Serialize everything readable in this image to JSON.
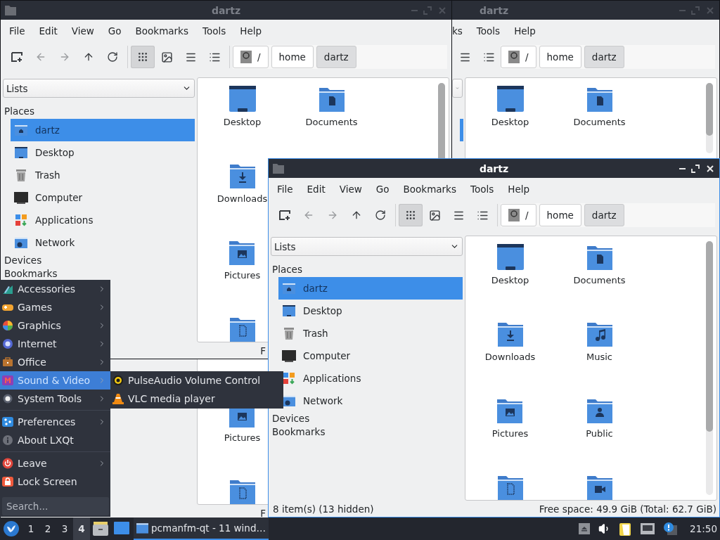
{
  "windows": [
    {
      "title": "dartz",
      "active": false,
      "menu": [
        "File",
        "Edit",
        "View",
        "Go",
        "Bookmarks",
        "Tools",
        "Help"
      ],
      "view_buttons": [
        {
          "kind": "icons",
          "selected": true
        },
        {
          "kind": "thumbnails",
          "selected": false
        },
        {
          "kind": "details",
          "selected": false
        },
        {
          "kind": "compact",
          "selected": false
        }
      ],
      "path": [
        {
          "label": "/",
          "selected": false
        },
        {
          "label": "home",
          "selected": false
        },
        {
          "label": "dartz",
          "selected": true
        }
      ],
      "view_selector": "Lists",
      "places_heading": "Places",
      "places": [
        {
          "label": "dartz",
          "kind": "home",
          "selected": true
        },
        {
          "label": "Desktop",
          "kind": "desktop",
          "selected": false
        },
        {
          "label": "Trash",
          "kind": "trash",
          "selected": false
        },
        {
          "label": "Computer",
          "kind": "computer",
          "selected": false
        },
        {
          "label": "Applications",
          "kind": "applications",
          "selected": false
        },
        {
          "label": "Network",
          "kind": "network",
          "selected": false
        }
      ],
      "sections": [
        "Devices",
        "Bookmarks"
      ],
      "files": [
        {
          "label": "Desktop",
          "kind": "desktop"
        },
        {
          "label": "Documents",
          "kind": "documents"
        },
        {
          "label": "Downloads",
          "kind": "downloads"
        },
        {
          "label": "Pictures",
          "kind": "pictures"
        },
        {
          "kind": "templates"
        }
      ],
      "status_right": "F"
    },
    {
      "title": "dartz",
      "active": false,
      "menu": [
        "ks",
        "Tools",
        "Help"
      ],
      "view_buttons": [
        {
          "kind": "details",
          "selected": false
        },
        {
          "kind": "compact",
          "selected": false
        }
      ],
      "path": [
        {
          "label": "/",
          "selected": false
        },
        {
          "label": "home",
          "selected": false
        },
        {
          "label": "dartz",
          "selected": true
        }
      ],
      "places": [
        {
          "selected": true
        }
      ],
      "files": [
        {
          "label": "Desktop",
          "kind": "desktop"
        },
        {
          "label": "Documents",
          "kind": "documents"
        }
      ]
    },
    {
      "files": [
        {
          "label": "Pictures",
          "kind": "pictures"
        },
        {
          "kind": "templates"
        }
      ],
      "status_right": "F"
    },
    {
      "title": "dartz",
      "active": true,
      "menu": [
        "File",
        "Edit",
        "View",
        "Go",
        "Bookmarks",
        "Tools",
        "Help"
      ],
      "view_buttons": [
        {
          "kind": "icons",
          "selected": true
        },
        {
          "kind": "thumbnails",
          "selected": false
        },
        {
          "kind": "details",
          "selected": false
        },
        {
          "kind": "compact",
          "selected": false
        }
      ],
      "path": [
        {
          "label": "/",
          "selected": false
        },
        {
          "label": "home",
          "selected": false
        },
        {
          "label": "dartz",
          "selected": true
        }
      ],
      "view_selector": "Lists",
      "places_heading": "Places",
      "places": [
        {
          "label": "dartz",
          "kind": "home",
          "selected": true
        },
        {
          "label": "Desktop",
          "kind": "desktop",
          "selected": false
        },
        {
          "label": "Trash",
          "kind": "trash",
          "selected": false
        },
        {
          "label": "Computer",
          "kind": "computer",
          "selected": false
        },
        {
          "label": "Applications",
          "kind": "applications",
          "selected": false
        },
        {
          "label": "Network",
          "kind": "network",
          "selected": false
        }
      ],
      "sections": [
        "Devices",
        "Bookmarks"
      ],
      "files": [
        {
          "label": "Desktop",
          "kind": "desktop"
        },
        {
          "label": "Documents",
          "kind": "documents"
        },
        {
          "label": "Downloads",
          "kind": "downloads"
        },
        {
          "label": "Music",
          "kind": "music"
        },
        {
          "label": "Pictures",
          "kind": "pictures"
        },
        {
          "label": "Public",
          "kind": "public"
        },
        {
          "kind": "templates"
        },
        {
          "kind": "videos"
        }
      ],
      "status_left": "8 item(s) (13 hidden)",
      "status_right": "Free space: 49.9 GiB (Total: 62.7 GiB)"
    }
  ],
  "start_menu": {
    "groups": [
      [
        {
          "label": "Accessories",
          "kind": "accessories",
          "submenu": true,
          "selected": false
        },
        {
          "label": "Games",
          "kind": "games",
          "submenu": true,
          "selected": false
        },
        {
          "label": "Graphics",
          "kind": "graphics",
          "submenu": true,
          "selected": false
        },
        {
          "label": "Internet",
          "kind": "internet",
          "submenu": true,
          "selected": false
        },
        {
          "label": "Office",
          "kind": "office",
          "submenu": true,
          "selected": false
        },
        {
          "label": "Sound & Video",
          "kind": "media",
          "submenu": true,
          "selected": true
        },
        {
          "label": "System Tools",
          "kind": "system",
          "submenu": true,
          "selected": false
        }
      ],
      [
        {
          "label": "Preferences",
          "kind": "preferences",
          "submenu": true,
          "selected": false
        },
        {
          "label": "About LXQt",
          "kind": "about",
          "submenu": false,
          "selected": false
        }
      ],
      [
        {
          "label": "Leave",
          "kind": "leave",
          "submenu": true,
          "selected": false
        },
        {
          "label": "Lock Screen",
          "kind": "lock",
          "submenu": false,
          "selected": false
        }
      ]
    ],
    "search": {
      "placeholder": "Search..."
    },
    "submenu": [
      {
        "label": "PulseAudio Volume Control",
        "kind": "pulseaudio"
      },
      {
        "label": "VLC media player",
        "kind": "vlc"
      }
    ]
  },
  "taskbar": {
    "desktops": [
      {
        "label": "1",
        "selected": false
      },
      {
        "label": "2",
        "selected": false
      },
      {
        "label": "3",
        "selected": false
      },
      {
        "label": "4",
        "selected": true
      }
    ],
    "task": {
      "label": "pcmanfm-qt - 11 wind…",
      "selected": true
    },
    "clock": "21:50"
  }
}
